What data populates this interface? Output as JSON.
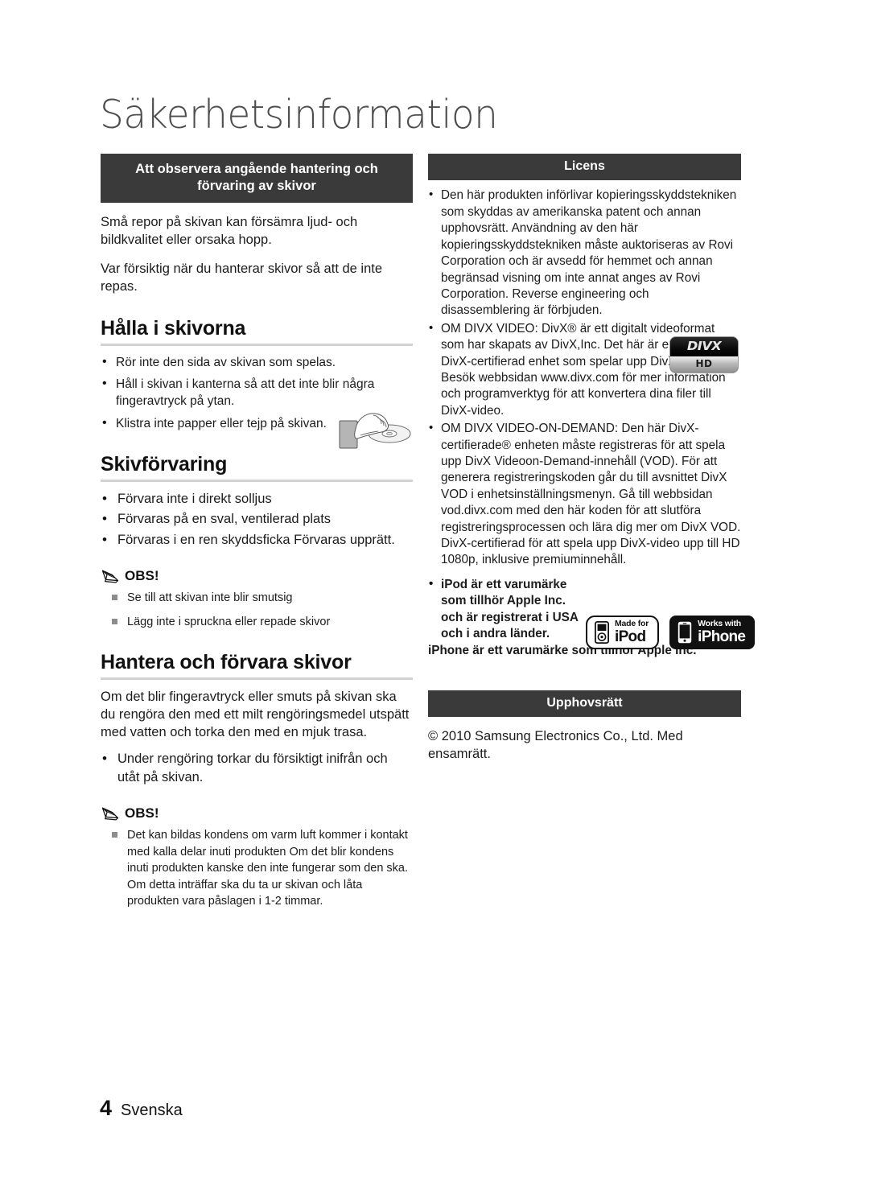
{
  "page": {
    "title": "Säkerhetsinformation",
    "footer": {
      "number": "4",
      "language": "Svenska"
    },
    "colors": {
      "banner_bg": "#3a3a3a",
      "rule": "#d2d2d2",
      "text": "#1c1c1c"
    }
  },
  "left": {
    "banner": "Att observera angående hantering och förvaring av skivor",
    "intro_paragraphs": [
      "Små repor på skivan kan försämra ljud- och bildkvalitet eller orsaka hopp.",
      "Var försiktig när du hanterar skivor så att de inte repas."
    ],
    "section_hold": {
      "heading": "Hålla i skivorna",
      "bullets": [
        "Rör inte den sida av skivan som spelas.",
        "Håll i skivan i kanterna så att det inte blir några fingeravtryck på ytan.",
        "Klistra inte papper eller tejp på skivan."
      ]
    },
    "section_storage": {
      "heading": "Skivförvaring",
      "bullets": [
        "Förvara inte i direkt solljus",
        "Förvaras på en sval, ventilerad plats",
        "Förvaras i en ren skyddsficka Förvaras upprätt."
      ]
    },
    "note_one": {
      "label": "OBS!",
      "items": [
        "Se till att skivan inte blir smutsig",
        "Lägg inte i spruckna eller repade skivor"
      ]
    },
    "section_handle": {
      "heading": "Hantera och förvara skivor",
      "paragraph": "Om det blir fingeravtryck eller smuts på skivan ska du rengöra den med ett milt rengöringsmedel utspätt med vatten och torka den med en mjuk trasa.",
      "bullets": [
        "Under rengöring torkar du försiktigt inifrån och utåt på skivan."
      ]
    },
    "note_two": {
      "label": "OBS!",
      "items": [
        "Det kan bildas kondens om varm luft kommer i kontakt med kalla delar inuti produkten Om det blir kondens inuti produkten kanske den inte fungerar som den ska. Om detta inträffar ska du ta ur skivan och låta produkten vara påslagen i 1-2 timmar."
      ]
    }
  },
  "right": {
    "licens_banner": "Licens",
    "licens_bullets": [
      "Den här produkten införlivar kopieringsskyddstekniken som skyddas av amerikanska patent och annan upphovsrätt. Användning av den här kopieringsskyddstekniken måste auktoriseras av Rovi Corporation och är avsedd för hemmet och annan begränsad visning om inte annat anges av Rovi Corporation. Reverse engineering och disassemblering är förbjuden.",
      "OM DIVX VIDEO: DivX® är ett digitalt videoformat som har skapats av DivX,Inc. Det här är en officiell DivX-certifierad enhet som spelar upp DivX-video. Besök webbsidan www.divx.com för mer information och programverktyg för att konvertera dina filer till DivX-video.",
      "OM DIVX VIDEO-ON-DEMAND: Den här DivX-certifierade® enheten måste registreras för att spela upp DivX Videoon-Demand-innehåll (VOD). För att generera registreringskoden går du till avsnittet DivX VOD i enhetsinställningsmenyn. Gå till webbsidan vod.divx.com med den här koden för att slutföra registreringsprocessen och lära dig mer om DivX VOD. DivX-certifierad för att spela upp DivX-video upp till HD 1080p, inklusive premiuminnehåll."
    ],
    "ipod_bullet": "iPod är ett varumärke som tillhör Apple Inc. och är registrerat i USA och i andra länder.",
    "iphone_line": "iPhone är ett varumärke som tillhör Apple Inc.",
    "divx_logo": {
      "top_text": "DIVX",
      "bottom_text": "HD"
    },
    "badges": [
      {
        "small": "Made for",
        "big": "iPod"
      },
      {
        "small": "Works with",
        "big": "iPhone"
      }
    ],
    "copyright_banner": "Upphovsrätt",
    "copyright_text": "© 2010 Samsung Electronics Co., Ltd. Med ensamrätt."
  }
}
